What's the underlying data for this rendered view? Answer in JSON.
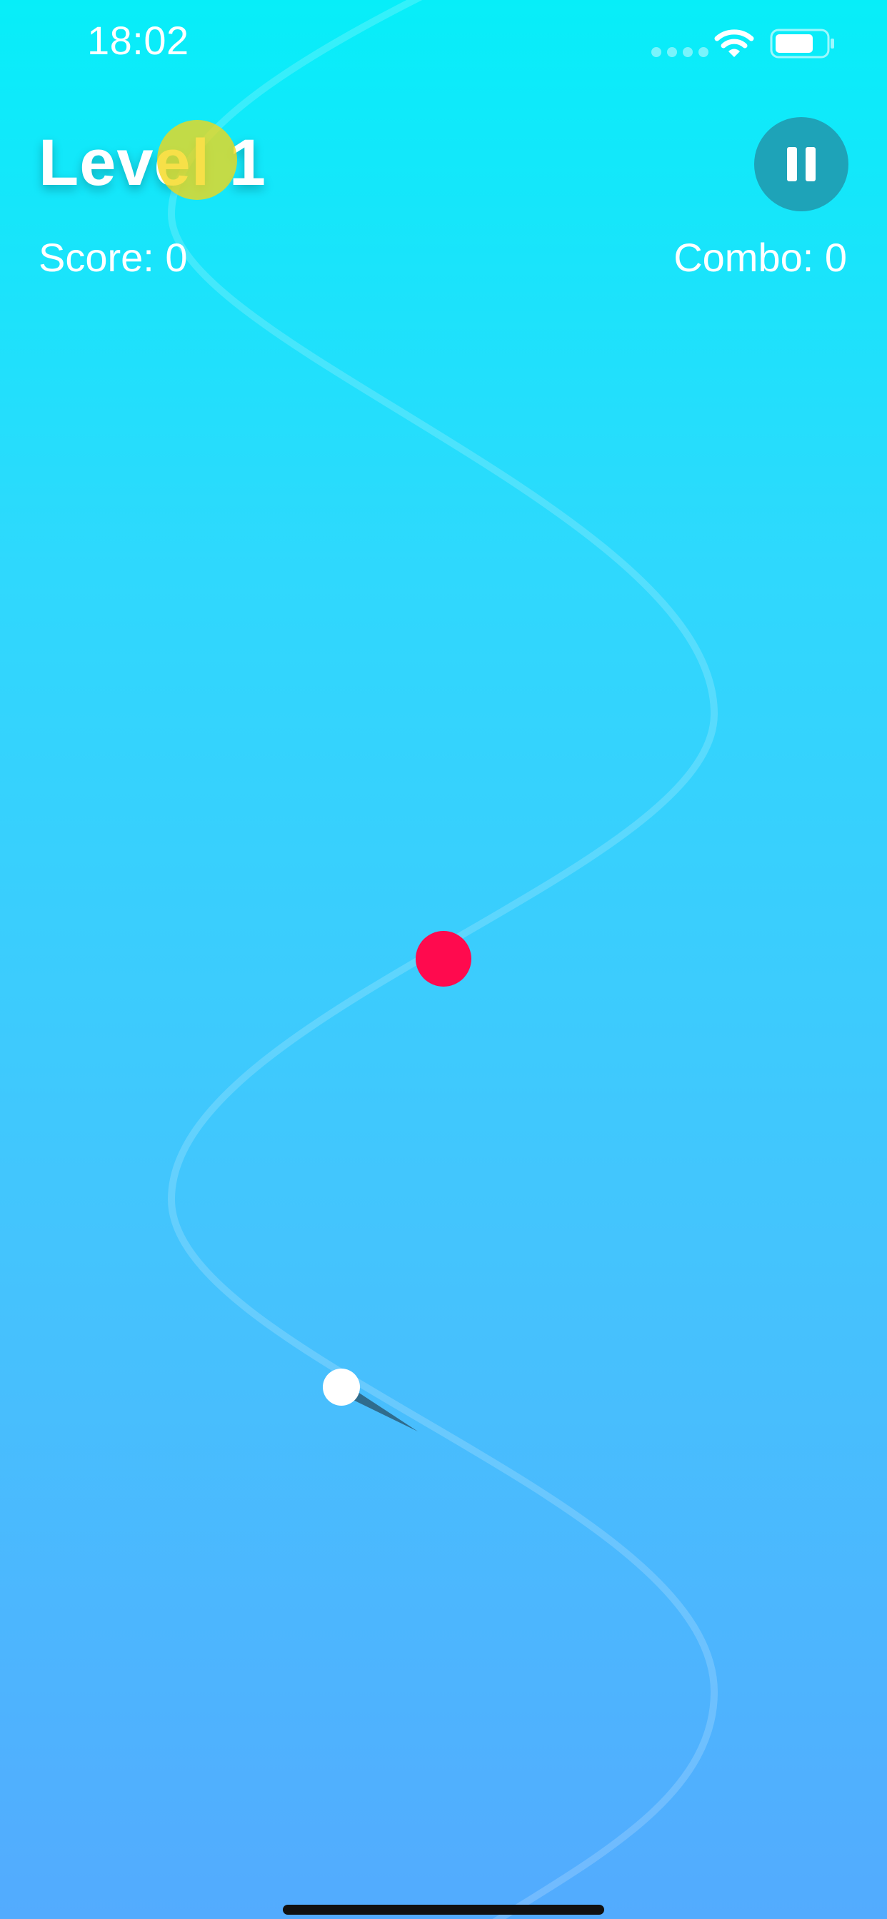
{
  "status_bar": {
    "time": "18:02",
    "icons": [
      "signal-dots-icon",
      "wifi-icon",
      "battery-icon"
    ]
  },
  "hud": {
    "level_title": "Level 1",
    "score_text": "Score: 0",
    "combo_text": "Combo: 0",
    "pause_icon": "pause-icon"
  },
  "colors": {
    "background_top": "#07eef9",
    "background_bottom": "#53abfe",
    "target_dot": "#ff0a4e",
    "yellow_orb": "#f5d714",
    "pause_button": "#1ea3b8",
    "path": "#ffffff"
  }
}
